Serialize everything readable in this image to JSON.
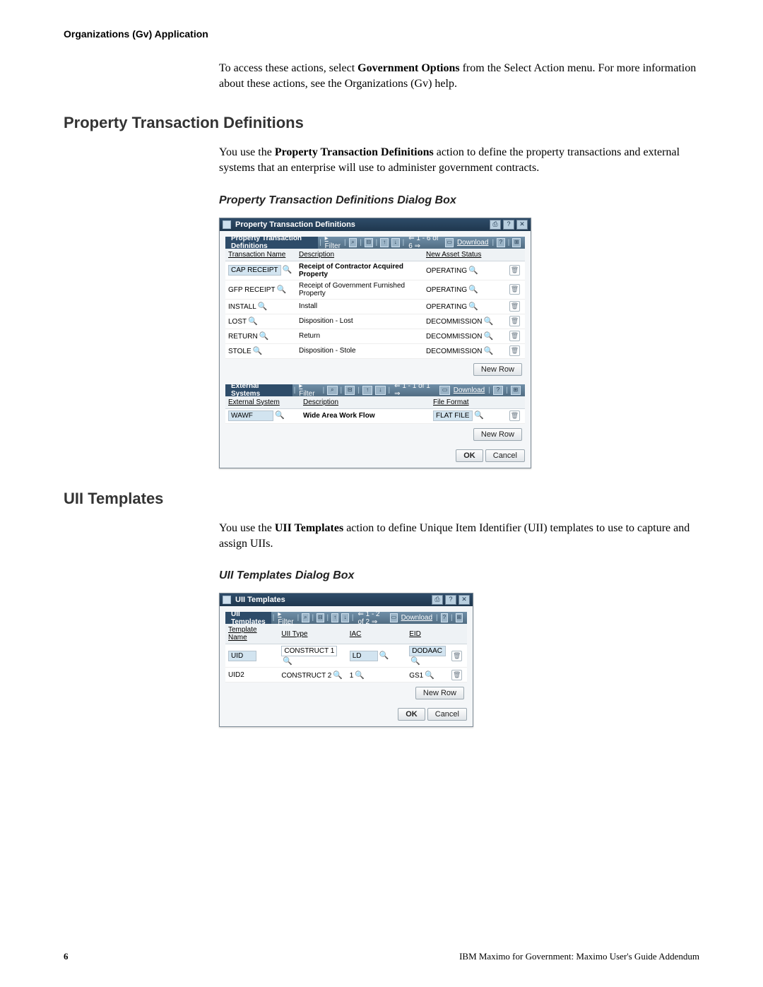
{
  "running_header": "Organizations (Gv) Application",
  "intro": {
    "line1_pre": "To access these actions, select ",
    "line1_bold": "Government Options",
    "line1_post": " from the Select Action menu. For more information about these actions, see the Organizations (Gv) help."
  },
  "section1": {
    "heading": "Property Transaction Definitions",
    "para_pre": "You use the ",
    "para_bold": "Property Transaction Definitions",
    "para_post": " action to define the property transactions and external systems that an enterprise will use to administer government contracts.",
    "sub": "Property Transaction Definitions Dialog Box"
  },
  "dlg1": {
    "title": "Property Transaction Definitions",
    "sec1_title": "Property Transaction Definitions",
    "filter": "Filter",
    "find": "⌕",
    "range": "1 - 6 of 6",
    "download": "Download",
    "help_icon": "?",
    "col_txn": "Transaction Name",
    "col_desc": "Description",
    "col_status": "New Asset Status",
    "rows": [
      {
        "txn": "CAP RECEIPT",
        "desc": "Receipt of Contractor Acquired Property",
        "status": "OPERATING",
        "hl": true
      },
      {
        "txn": "GFP RECEIPT",
        "desc": "Receipt of Government Furnished Property",
        "status": "OPERATING",
        "hl": false
      },
      {
        "txn": "INSTALL",
        "desc": "Install",
        "status": "OPERATING",
        "hl": false
      },
      {
        "txn": "LOST",
        "desc": "Disposition - Lost",
        "status": "DECOMMISSION",
        "hl": false
      },
      {
        "txn": "RETURN",
        "desc": "Return",
        "status": "DECOMMISSION",
        "hl": false
      },
      {
        "txn": "STOLE",
        "desc": "Disposition - Stole",
        "status": "DECOMMISSION",
        "hl": false
      }
    ],
    "new_row": "New Row",
    "sec2_title": "External Systems",
    "range2": "1 - 1 of 1",
    "col_extsys": "External System",
    "col_desc2": "Description",
    "col_ff": "File Format",
    "ext_rows": [
      {
        "sys": "WAWF",
        "desc": "Wide Area Work Flow",
        "ff": "FLAT FILE",
        "hl": true
      }
    ],
    "ok": "OK",
    "cancel": "Cancel"
  },
  "section2": {
    "heading": "UII Templates",
    "para_pre": "You use the ",
    "para_bold": "UII Templates",
    "para_post": " action to define Unique Item Identifier (UII) templates to use to capture and assign UIIs.",
    "sub": "UII Templates Dialog Box"
  },
  "dlg2": {
    "title": "UII Templates",
    "sec_title": "UII Templates",
    "filter": "Filter",
    "range": "1 - 2 of 2",
    "download": "Download",
    "col_tpl": "Template Name",
    "col_type": "UII Type",
    "col_iac": "IAC",
    "col_eid": "EID",
    "rows": [
      {
        "tpl": "UID",
        "type": "CONSTRUCT 1",
        "iac": "LD",
        "eid": "DODAAC",
        "hl": true
      },
      {
        "tpl": "UID2",
        "type": "CONSTRUCT 2",
        "iac": "1",
        "eid": "GS1",
        "hl": false
      }
    ],
    "new_row": "New Row",
    "ok": "OK",
    "cancel": "Cancel"
  },
  "footer": {
    "page": "6",
    "doc": "IBM Maximo for Government: Maximo User's Guide Addendum"
  }
}
